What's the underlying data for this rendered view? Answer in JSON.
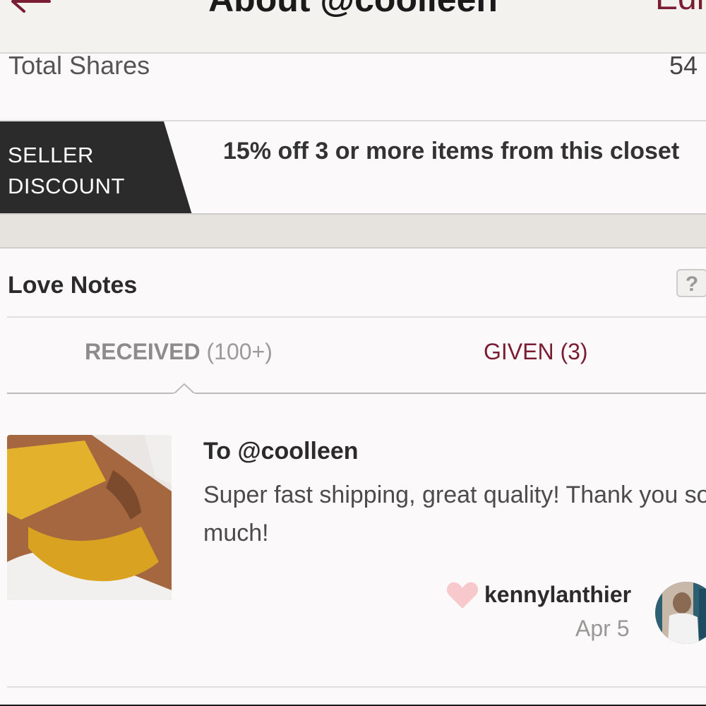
{
  "header": {
    "title": "About @coolleen",
    "edit_label": "Edi",
    "back_icon": "arrow-left-icon"
  },
  "stats": {
    "total_shares_label": "Total Shares",
    "total_shares_value": "54"
  },
  "seller_discount": {
    "badge_line1": "SELLER",
    "badge_line2": "DISCOUNT",
    "text": "15% off 3 or more items from this closet"
  },
  "love_notes": {
    "title": "Love Notes",
    "help_icon_text": "?",
    "tabs": [
      {
        "label": "RECEIVED",
        "count": "(100+)",
        "active": true
      },
      {
        "label": "GIVEN",
        "count": "(3)",
        "active": false
      }
    ],
    "note": {
      "to": "To @coolleen",
      "body": "Super fast shipping, great quality! Thank you so much!",
      "author": "kennylanthier",
      "date": "Apr 5"
    }
  },
  "colors": {
    "accent": "#7a1d32",
    "badge_background": "#2b2b2b",
    "heart": "#f7c8cc"
  }
}
